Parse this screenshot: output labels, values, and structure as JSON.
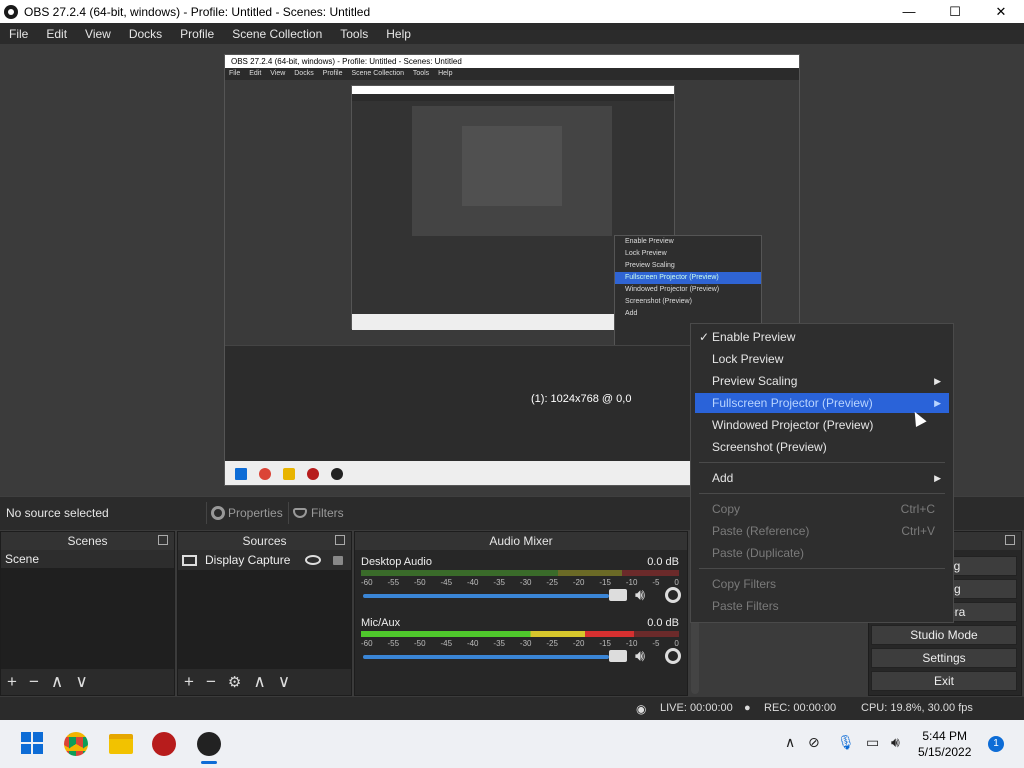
{
  "window": {
    "title": "OBS 27.2.4 (64-bit, windows) - Profile: Untitled - Scenes: Untitled",
    "minimize": "—",
    "maximize": "☐",
    "close": "✕"
  },
  "menubar": [
    "File",
    "Edit",
    "View",
    "Docks",
    "Profile",
    "Scene Collection",
    "Tools",
    "Help"
  ],
  "preview": {
    "nested_title": "OBS 27.2.4 (64-bit, windows) - Profile: Untitled - Scenes: Untitled",
    "nested_menu": [
      "File",
      "Edit",
      "View",
      "Docks",
      "Profile",
      "Scene Collection",
      "Tools",
      "Help"
    ],
    "nested_ctx": [
      "Enable Preview",
      "Lock Preview",
      "Preview Scaling",
      "Fullscreen Projector (Preview)",
      "Windowed Projector (Preview)",
      "Screenshot (Preview)",
      "Add"
    ],
    "resolution_label": "(1): 1024x768 @ 0,0"
  },
  "toolbar": {
    "no_source": "No source selected",
    "properties": "Properties",
    "filters": "Filters"
  },
  "scenes": {
    "title": "Scenes",
    "items": [
      "Scene"
    ]
  },
  "sources": {
    "title": "Sources",
    "items": [
      "Display Capture"
    ]
  },
  "mixer": {
    "title": "Audio Mixer",
    "channels": [
      {
        "name": "Desktop Audio",
        "db": "0.0 dB",
        "level": 0.0
      },
      {
        "name": "Mic/Aux",
        "db": "0.0 dB",
        "level": 0.86
      }
    ],
    "ticks": [
      "-60",
      "-55",
      "-50",
      "-45",
      "-40",
      "-35",
      "-30",
      "-25",
      "-20",
      "-15",
      "-10",
      "-5",
      "0"
    ]
  },
  "controls": {
    "items": [
      "aming",
      "ording",
      "Camera",
      "Studio Mode",
      "Settings",
      "Exit"
    ]
  },
  "context_menu": {
    "items": [
      {
        "label": "Enable Preview",
        "checked": true
      },
      {
        "label": "Lock Preview"
      },
      {
        "label": "Preview Scaling",
        "submenu": true
      },
      {
        "label": "Fullscreen Projector (Preview)",
        "submenu": true,
        "highlighted": true
      },
      {
        "label": "Windowed Projector (Preview)"
      },
      {
        "label": "Screenshot (Preview)"
      },
      {
        "label": "Add",
        "submenu": true
      },
      {
        "label": "Copy",
        "shortcut": "Ctrl+C",
        "disabled": true
      },
      {
        "label": "Paste (Reference)",
        "shortcut": "Ctrl+V",
        "disabled": true
      },
      {
        "label": "Paste (Duplicate)",
        "disabled": true
      },
      {
        "label": "Copy Filters",
        "disabled": true
      },
      {
        "label": "Paste Filters",
        "disabled": true
      }
    ]
  },
  "status": {
    "live": "LIVE: 00:00:00",
    "rec": "REC: 00:00:00",
    "cpu": "CPU: 19.8%, 30.00 fps"
  },
  "taskbar": {
    "time": "5:44 PM",
    "date": "5/15/2022",
    "notifications": "1"
  }
}
